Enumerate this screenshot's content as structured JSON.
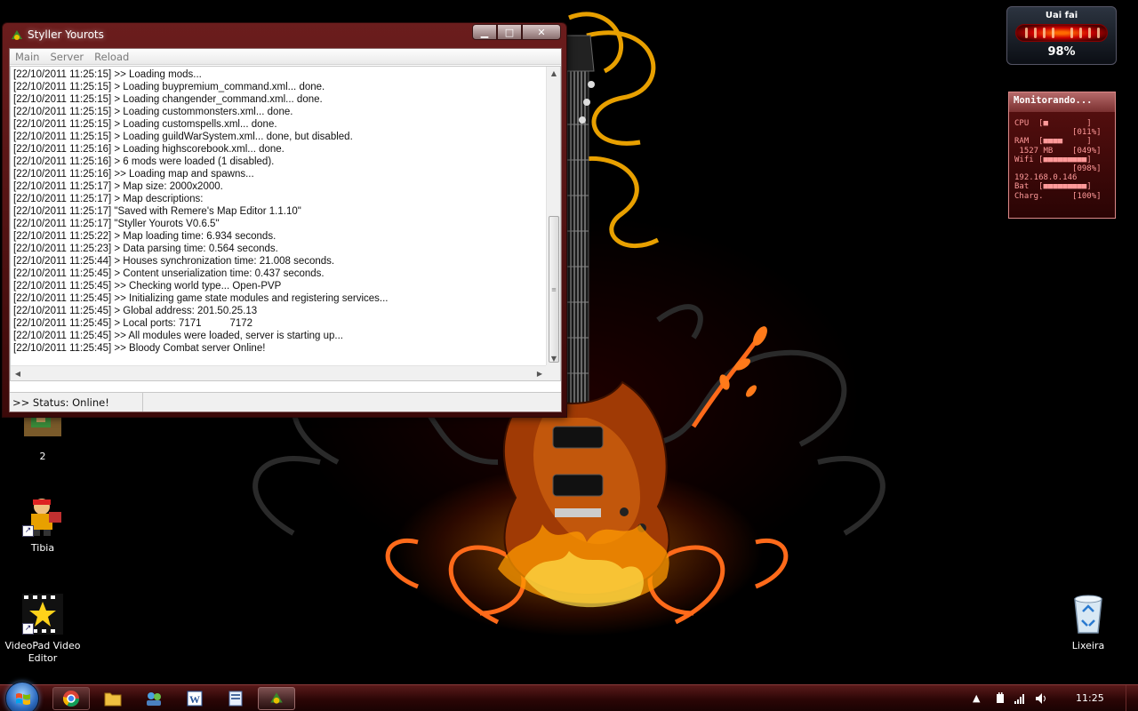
{
  "window": {
    "title": "Styller Yourots",
    "menu": [
      "Main",
      "Server",
      "Reload"
    ],
    "log_lines": [
      "[22/10/2011 11:25:15] >> Loading mods...",
      "[22/10/2011 11:25:15] > Loading buypremium_command.xml... done.",
      "[22/10/2011 11:25:15] > Loading changender_command.xml... done.",
      "[22/10/2011 11:25:15] > Loading custommonsters.xml... done.",
      "[22/10/2011 11:25:15] > Loading customspells.xml... done.",
      "[22/10/2011 11:25:15] > Loading guildWarSystem.xml... done, but disabled.",
      "[22/10/2011 11:25:16] > Loading highscorebook.xml... done.",
      "[22/10/2011 11:25:16] > 6 mods were loaded (1 disabled).",
      "[22/10/2011 11:25:16] >> Loading map and spawns...",
      "[22/10/2011 11:25:17] > Map size: 2000x2000.",
      "[22/10/2011 11:25:17] > Map descriptions:",
      "[22/10/2011 11:25:17] \"Saved with Remere's Map Editor 1.1.10\"",
      "[22/10/2011 11:25:17] \"Styller Yourots V0.6.5\"",
      "[22/10/2011 11:25:22] > Map loading time: 6.934 seconds.",
      "[22/10/2011 11:25:23] > Data parsing time: 0.564 seconds.",
      "[22/10/2011 11:25:44] > Houses synchronization time: 21.008 seconds.",
      "[22/10/2011 11:25:45] > Content unserialization time: 0.437 seconds.",
      "[22/10/2011 11:25:45] >> Checking world type... Open-PVP",
      "[22/10/2011 11:25:45] >> Initializing game state modules and registering services...",
      "[22/10/2011 11:25:45] > Global address: 201.50.25.13",
      "[22/10/2011 11:25:45] > Local ports: 7171          7172",
      "[22/10/2011 11:25:45] >> All modules were loaded, server is starting up...",
      "[22/10/2011 11:25:45] >> Bloody Combat server Online!"
    ],
    "status": ">> Status: Online!"
  },
  "desktop": {
    "icons": [
      {
        "label": "2",
        "icon": "game-map-icon"
      },
      {
        "label": "Tibia",
        "icon": "tibia-character-icon"
      },
      {
        "label": "VideoPad Video Editor",
        "icon": "star-film-icon"
      },
      {
        "label": "Lixeira",
        "icon": "recycle-bin-icon"
      }
    ]
  },
  "gadgets": {
    "meter": {
      "title": "Uai fai",
      "value": "98%"
    },
    "monitor": {
      "title": "Monitorando...",
      "lines": [
        "CPU  [■        ]",
        "            [011%]",
        "RAM  [■■■■     ]",
        " 1527 MB    [049%]",
        "Wifi [■■■■■■■■■]",
        "            [098%]",
        "192.168.0.146",
        "Bat  [■■■■■■■■■]",
        "Charg.      [100%]"
      ]
    }
  },
  "taskbar": {
    "clock": "11:25",
    "apps": [
      "chrome-icon",
      "explorer-folder-icon",
      "network-users-icon",
      "word-icon",
      "notepad-icon",
      "styller-server-icon"
    ]
  },
  "colors": {
    "titlebar": "#6b1d1d",
    "taskbar": "#3c0909",
    "accent_orange": "#ff6a00"
  }
}
